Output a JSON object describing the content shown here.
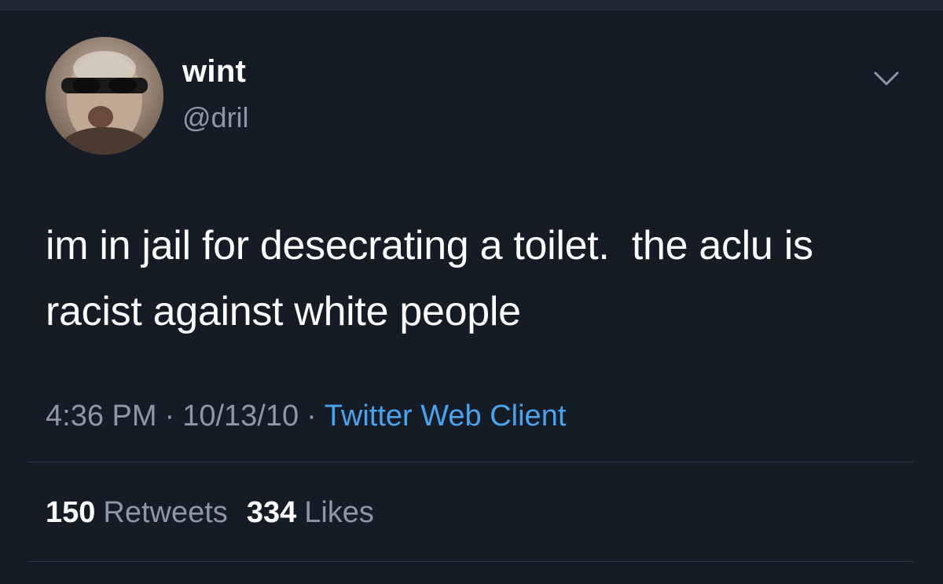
{
  "user": {
    "display_name": "wint",
    "handle": "@dril"
  },
  "tweet": {
    "text": "im in jail for desecrating a toilet.  the aclu is racist against white people",
    "time": "4:36 PM",
    "separator": "·",
    "date": "10/13/10",
    "client": "Twitter Web Client"
  },
  "stats": {
    "retweets_count": "150",
    "retweets_label": "Retweets",
    "likes_count": "334",
    "likes_label": "Likes"
  },
  "colors": {
    "background": "#151c26",
    "text_primary": "#ffffff",
    "text_secondary": "#8b98a5",
    "link": "#4aa3ef",
    "divider": "#2f3b48"
  },
  "icons": {
    "menu": "chevron-down-icon",
    "avatar": "profile-photo"
  }
}
